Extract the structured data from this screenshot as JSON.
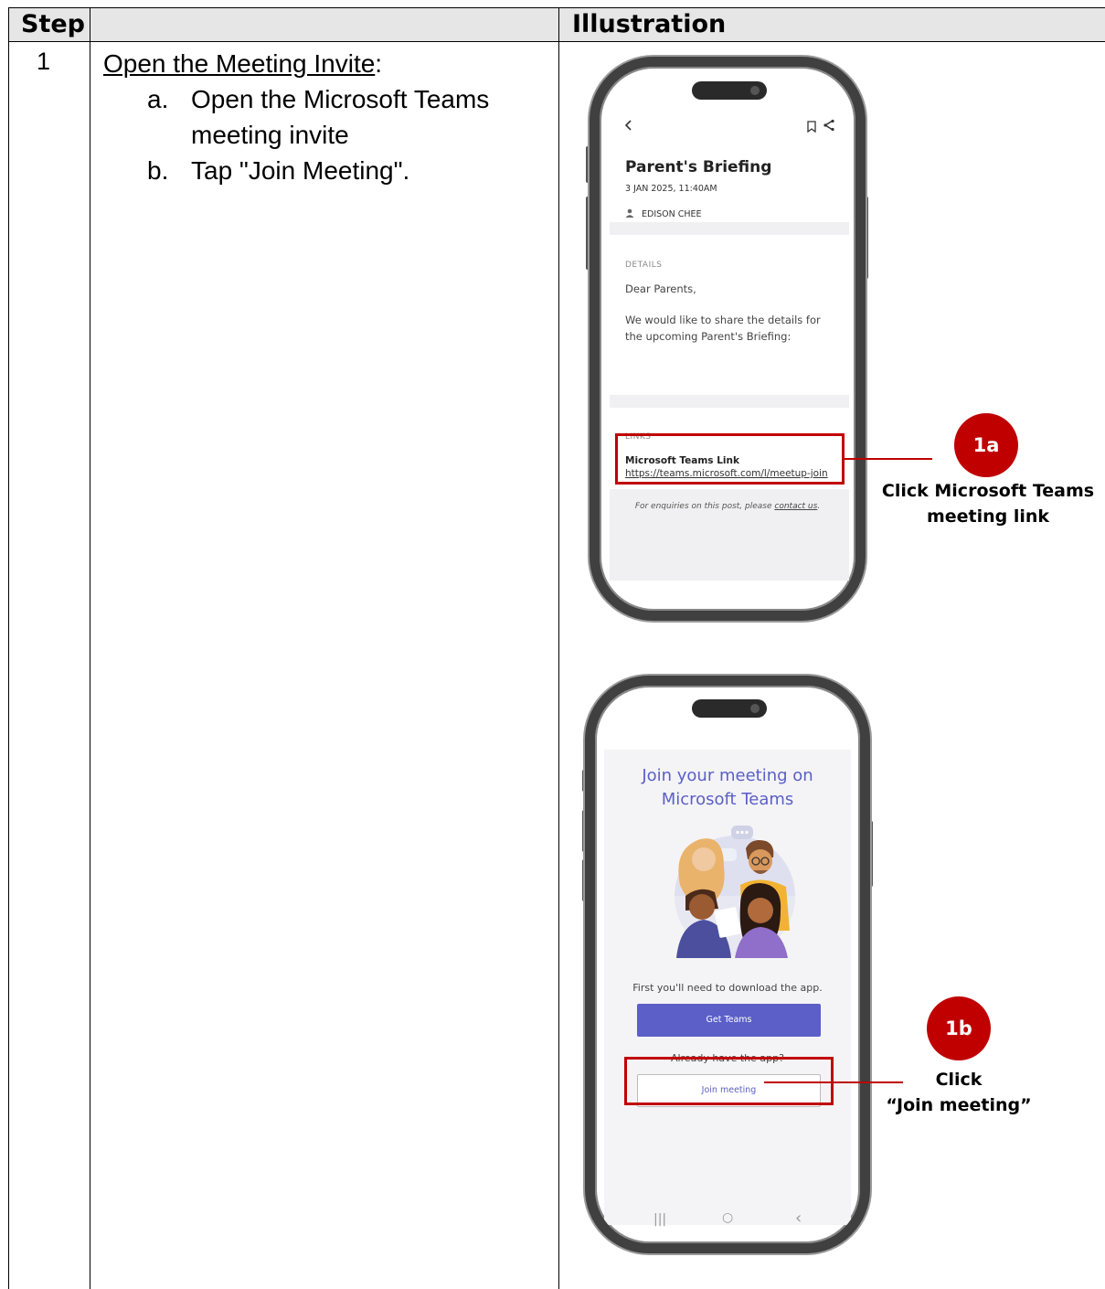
{
  "table": {
    "headers": {
      "step": "Step",
      "illustration": "Illustration"
    },
    "rows": [
      {
        "number": "1",
        "title": "Open the Meeting Invite",
        "title_suffix": ":",
        "substeps": [
          {
            "marker": "a.",
            "text": "Open the Microsoft Teams meeting invite"
          },
          {
            "marker": "b.",
            "text": "Tap \"Join Meeting\"."
          }
        ]
      }
    ]
  },
  "phone1": {
    "back_icon": "chevron-left-icon",
    "bookmark_icon": "bookmark-icon",
    "share_icon": "share-icon",
    "post_title": "Parent's Briefing",
    "date": "3 JAN 2025, 11:40AM",
    "author": "EDISON CHEE",
    "details_label": "DETAILS",
    "greeting": "Dear Parents,",
    "body": "We would like to share the details for the upcoming Parent's Briefing:",
    "links_label": "LINKS",
    "link_title": "Microsoft Teams Link",
    "link_url": "https://teams.microsoft.com/l/meetup-join",
    "footer_prefix": "For enquiries on this post, please ",
    "footer_link": "contact us",
    "footer_suffix": "."
  },
  "phone2": {
    "heading_line1": "Join your meeting on",
    "heading_line2": "Microsoft Teams",
    "download_text": "First you'll need to download the app.",
    "get_teams_label": "Get Teams",
    "already_text": "Already have the app?",
    "join_label": "Join meeting",
    "nav_recent": "|||",
    "nav_home": "○",
    "nav_back": "‹"
  },
  "callouts": [
    {
      "badge": "1a",
      "line1": "Click Microsoft Teams",
      "line2": "meeting link"
    },
    {
      "badge": "1b",
      "line1": "Click",
      "line2": "“Join meeting”"
    }
  ],
  "colors": {
    "accent_red": "#c00000",
    "teams_purple": "#5b5fc7",
    "header_gray": "#e7e6e6"
  }
}
